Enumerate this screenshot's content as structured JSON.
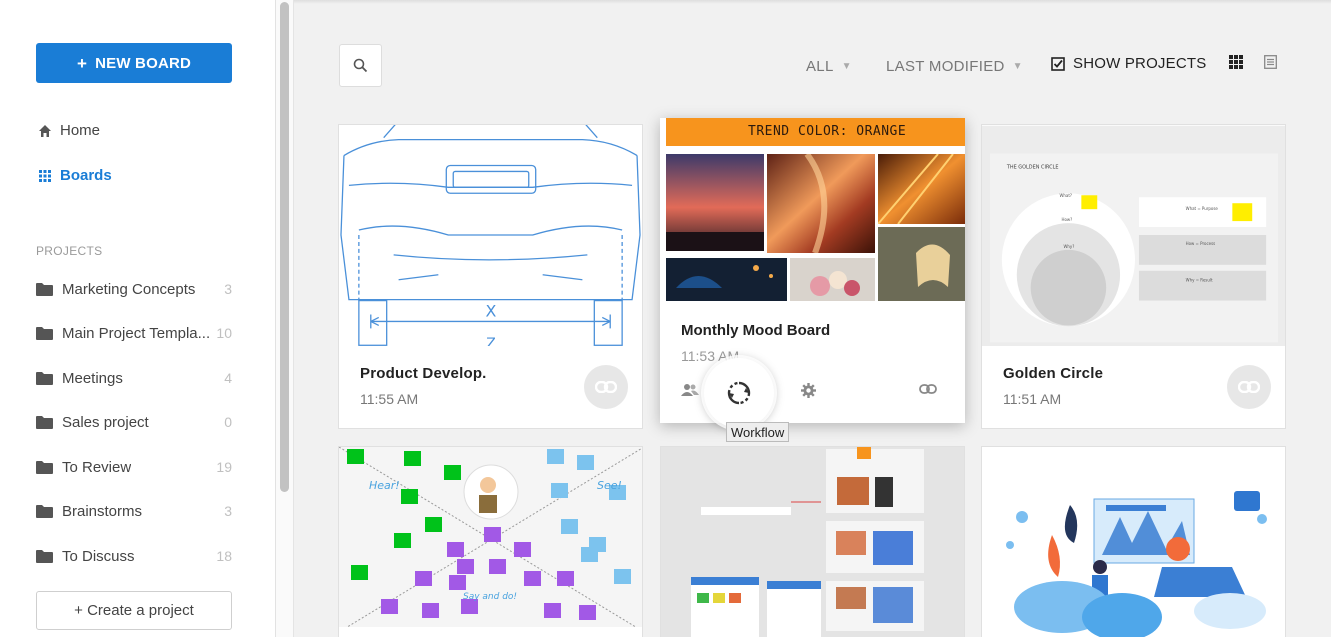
{
  "sidebar": {
    "new_board_label": "NEW BOARD",
    "nav": [
      {
        "label": "Home",
        "icon": "home-icon"
      },
      {
        "label": "Boards",
        "icon": "grid-icon"
      }
    ],
    "projects_title": "PROJECTS",
    "projects": [
      {
        "name": "Marketing Concepts",
        "count": "3"
      },
      {
        "name": "Main Project Templa...",
        "count": "10"
      },
      {
        "name": "Meetings",
        "count": "4"
      },
      {
        "name": "Sales project",
        "count": "0"
      },
      {
        "name": "To Review",
        "count": "19"
      },
      {
        "name": "Brainstorms",
        "count": "3"
      },
      {
        "name": "To Discuss",
        "count": "18"
      }
    ],
    "create_project_label": "+ Create a project"
  },
  "toolbar": {
    "filter_all": "ALL",
    "sort": "LAST MODIFIED",
    "show_projects": "SHOW PROJECTS"
  },
  "boards": [
    {
      "title": "Product Develop.",
      "time": "11:55 AM"
    },
    {
      "title": "Monthly Mood Board",
      "time": "11:53 AM",
      "mood_header": "TREND COLOR: ORANGE"
    },
    {
      "title": "Golden Circle",
      "time": "11:51 AM"
    }
  ],
  "tooltip": "Workflow",
  "colors": {
    "accent": "#1a7dd6",
    "mood_orange": "#f7941d",
    "sticky_green": "#00c21a",
    "sticky_purple": "#a259e6",
    "sticky_blue": "#7cc3ee",
    "sticky_yellow": "#ffff00"
  }
}
